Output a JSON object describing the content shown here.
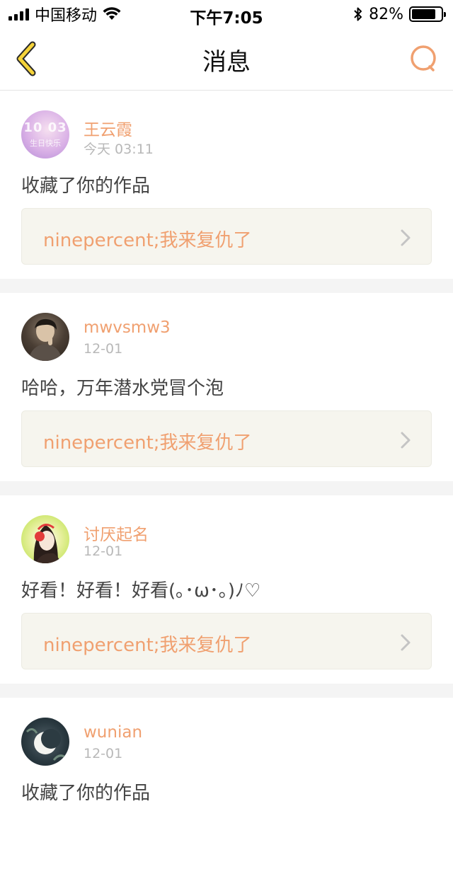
{
  "status_bar": {
    "carrier": "中国移动",
    "time": "下午7:05",
    "battery": "82%",
    "battery_level": 0.82,
    "icons": [
      "signal-icon",
      "wifi-icon",
      "bluetooth-icon",
      "battery-icon"
    ]
  },
  "nav": {
    "title": "消息",
    "back_icon": "chevron-left-icon",
    "search_icon": "search-icon",
    "accent_color": "#f0a070",
    "back_color": "#f5d33a"
  },
  "feed": [
    {
      "username": "王云霞",
      "time": "今天 03:11",
      "message": "收藏了你的作品",
      "work_title": "ninepercent;我来复仇了",
      "avatar_text": "10 03",
      "avatar_text_small": "生日快乐"
    },
    {
      "username": "mwvsmw3",
      "time": "12-01",
      "message": "哈哈，万年潜水党冒个泡",
      "work_title": "ninepercent;我来复仇了"
    },
    {
      "username": "讨厌起名",
      "time": "12-01",
      "message": "好看！好看！好看(｡･ω･｡)ﾉ♡",
      "work_title": "ninepercent;我来复仇了"
    },
    {
      "username": "wunian",
      "time": "12-01",
      "message": "收藏了你的作品"
    }
  ]
}
